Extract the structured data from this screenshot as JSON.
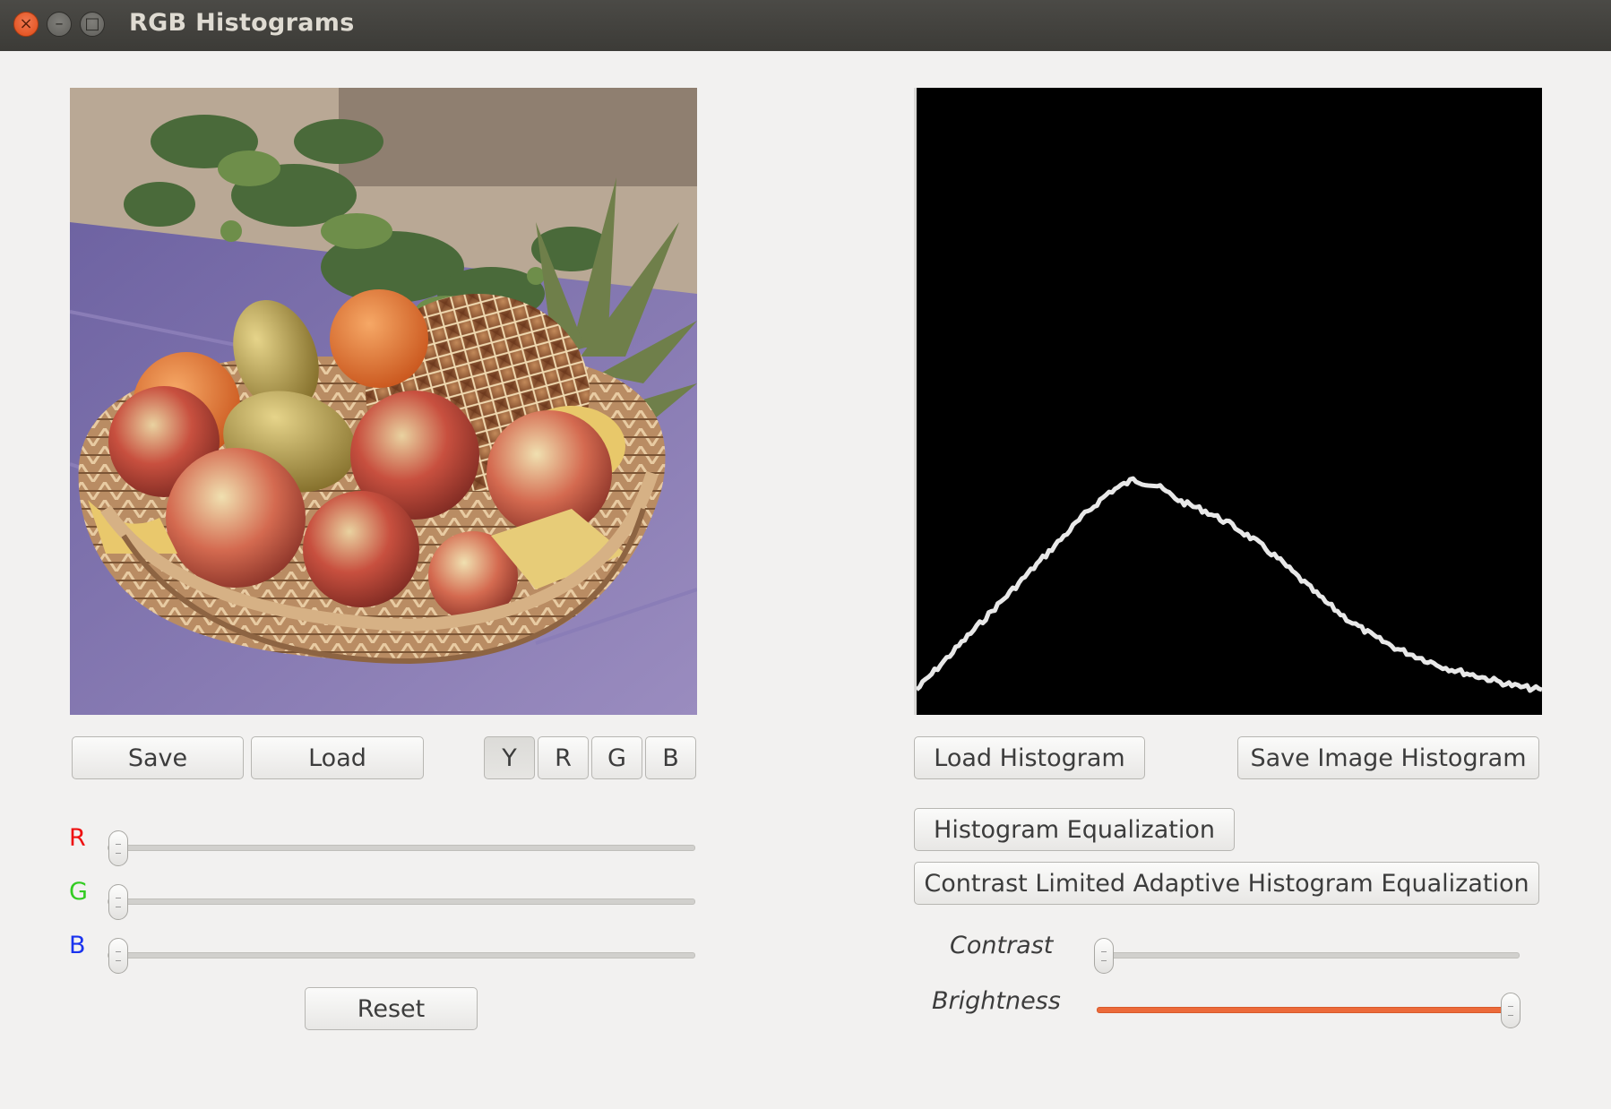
{
  "window": {
    "title": "RGB Histograms",
    "close_glyph": "×",
    "min_glyph": "–",
    "max_glyph": "□"
  },
  "image_panel": {
    "image_alt": "Fruit basket with apples, pears, oranges and pineapple on purple cloth",
    "save_label": "Save",
    "load_label": "Load",
    "channel_buttons": [
      "Y",
      "R",
      "G",
      "B"
    ],
    "selected_channel": "Y"
  },
  "rgb_sliders": {
    "r_label": "R",
    "g_label": "G",
    "b_label": "B",
    "r_value": 0,
    "g_value": 0,
    "b_value": 0,
    "r_color": "#ee1111",
    "g_color": "#33cc22",
    "b_color": "#1a33ee",
    "reset_label": "Reset"
  },
  "histogram_panel": {
    "load_histogram_label": "Load Histogram",
    "save_image_histogram_label": "Save Image Histogram",
    "histogram_equalization_label": "Histogram Equalization",
    "clahe_label": "Contrast Limited Adaptive Histogram Equalization",
    "contrast_label": "Contrast",
    "brightness_label": "Brightness",
    "contrast_value": 0,
    "brightness_value": 1.0,
    "accent_color": "#ec6a3a"
  },
  "histogram_curve": [
    0.04,
    0.08,
    0.12,
    0.16,
    0.2,
    0.24,
    0.28,
    0.32,
    0.355,
    0.375,
    0.365,
    0.34,
    0.325,
    0.305,
    0.28,
    0.25,
    0.215,
    0.18,
    0.15,
    0.125,
    0.105,
    0.09,
    0.075,
    0.065,
    0.055,
    0.045,
    0.04
  ]
}
